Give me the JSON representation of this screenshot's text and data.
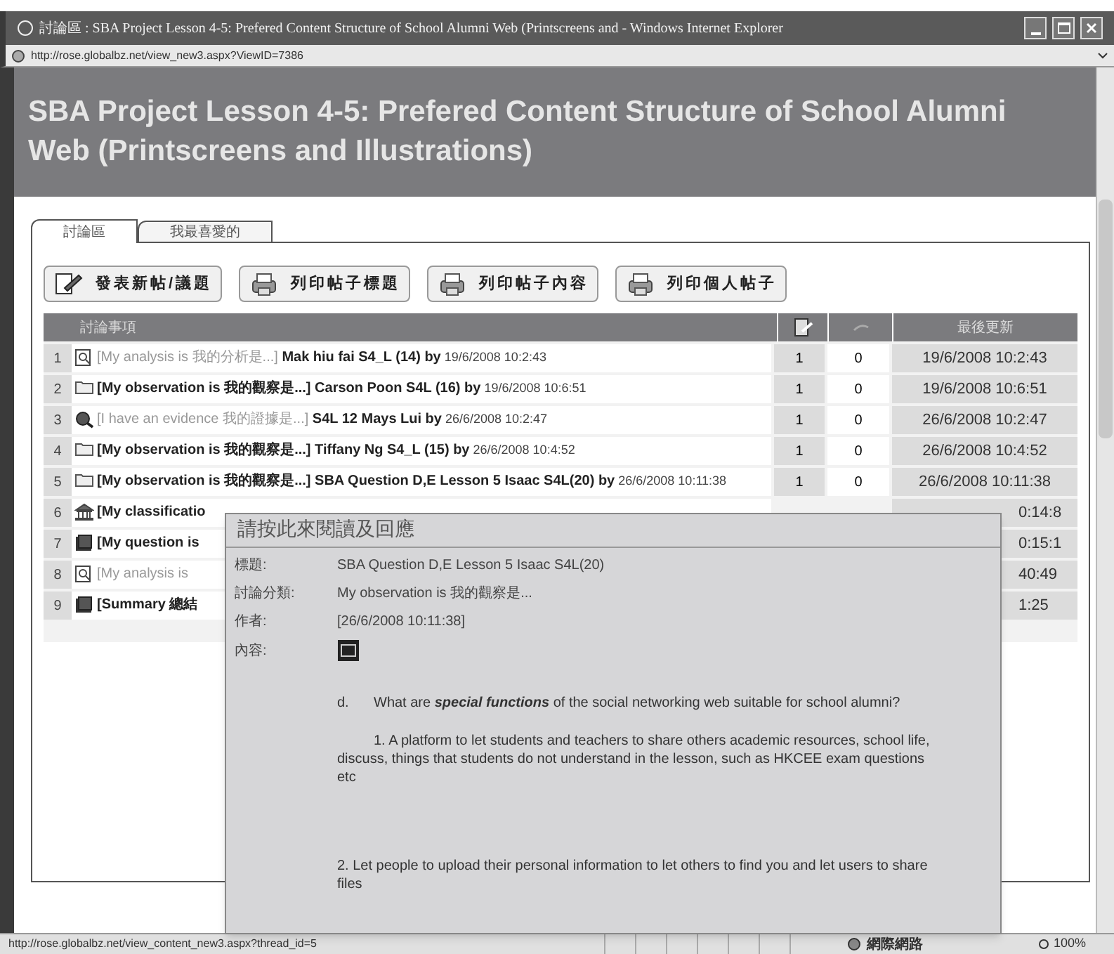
{
  "window": {
    "title": "討論區 : SBA Project Lesson 4-5: Prefered Content Structure of School Alumni Web (Printscreens and  - Windows Internet Explorer",
    "address": "http://rose.globalbz.net/view_new3.aspx?ViewID=7386"
  },
  "page_title": "SBA Project Lesson 4-5: Prefered Content Structure of School Alumni Web (Printscreens and Illustrations)",
  "tabs": [
    {
      "label": "討論區",
      "selected": true
    },
    {
      "label": "我最喜愛的",
      "selected": false
    }
  ],
  "buttons": [
    {
      "label": "發表新帖/議題",
      "kind": "post"
    },
    {
      "label": "列印帖子標題",
      "kind": "print"
    },
    {
      "label": "列印帖子內容",
      "kind": "print"
    },
    {
      "label": "列印個人帖子",
      "kind": "print"
    }
  ],
  "table": {
    "columns": [
      "討論事項",
      "最後更新"
    ],
    "rows": [
      {
        "index": "1",
        "kind": "analysis",
        "topic": "[My analysis is 我的分析是...]",
        "author": "Mak hiu fai S4_L (14) by",
        "date": "19/6/2008 10:2:43",
        "posts": "1",
        "replies": "0",
        "update": "19/6/2008 10:2:43",
        "covered": false
      },
      {
        "index": "2",
        "kind": "observation",
        "topic": "[My observation is 我的觀察是...]",
        "author": "Carson Poon S4L (16) by",
        "date": "19/6/2008 10:6:51",
        "posts": "1",
        "replies": "0",
        "update": "19/6/2008 10:6:51",
        "covered": false
      },
      {
        "index": "3",
        "kind": "evidence",
        "topic": "[I have an evidence 我的證據是...]",
        "author": "S4L 12 Mays Lui by",
        "date": "26/6/2008 10:2:47",
        "posts": "1",
        "replies": "0",
        "update": "26/6/2008 10:2:47",
        "covered": false
      },
      {
        "index": "4",
        "kind": "observation",
        "topic": "[My observation is 我的觀察是...]",
        "author": "Tiffany Ng S4_L (15) by",
        "date": "26/6/2008 10:4:52",
        "posts": "1",
        "replies": "0",
        "update": "26/6/2008 10:4:52",
        "covered": false
      },
      {
        "index": "5",
        "kind": "observation",
        "topic": "[My observation is 我的觀察是...]",
        "author": "SBA Question D,E Lesson 5 Isaac S4L(20) by",
        "date": "26/6/2008 10:11:38",
        "posts": "1",
        "replies": "0",
        "update": "26/6/2008 10:11:38",
        "covered": false
      },
      {
        "index": "6",
        "kind": "classification",
        "topic": "[My classificatio",
        "update": "0:14:8",
        "covered": true
      },
      {
        "index": "7",
        "kind": "question",
        "topic": "[My question is",
        "update": "0:15:1",
        "covered": true
      },
      {
        "index": "8",
        "kind": "analysis",
        "topic": "[My analysis is",
        "update": "40:49",
        "covered": true
      },
      {
        "index": "9",
        "kind": "summary",
        "topic": "[Summary 總結",
        "update": "1:25",
        "covered": true
      }
    ]
  },
  "popup": {
    "title": "請按此來閱讀及回應",
    "fields": [
      {
        "label": "標題:",
        "value": "SBA Question D,E Lesson 5 Isaac S4L(20)"
      },
      {
        "label": "討論分類:",
        "value": "My observation is 我的觀察是..."
      },
      {
        "label": "作者:",
        "value": "[26/6/2008 10:11:38]"
      }
    ],
    "content_label": "內容:",
    "paragraphs": [
      {
        "marker": "d.",
        "text": "What are **special functions** of the social networking web suitable for school alumni?",
        "indent": false
      },
      {
        "text": "1. A platform to let students and teachers to share others academic resources, school life, discuss, things that students do not understand in the lesson, such as HKCEE exam questions etc",
        "indent": true
      },
      {
        "text": "2. Let people to upload their personal information to let others to find you and let users to share files",
        "indent": false
      }
    ]
  },
  "status_bar": {
    "url": "http://rose.globalbz.net/view_content_new3.aspx?thread_id=5",
    "zone": "網際網路",
    "zoom": "100%"
  }
}
